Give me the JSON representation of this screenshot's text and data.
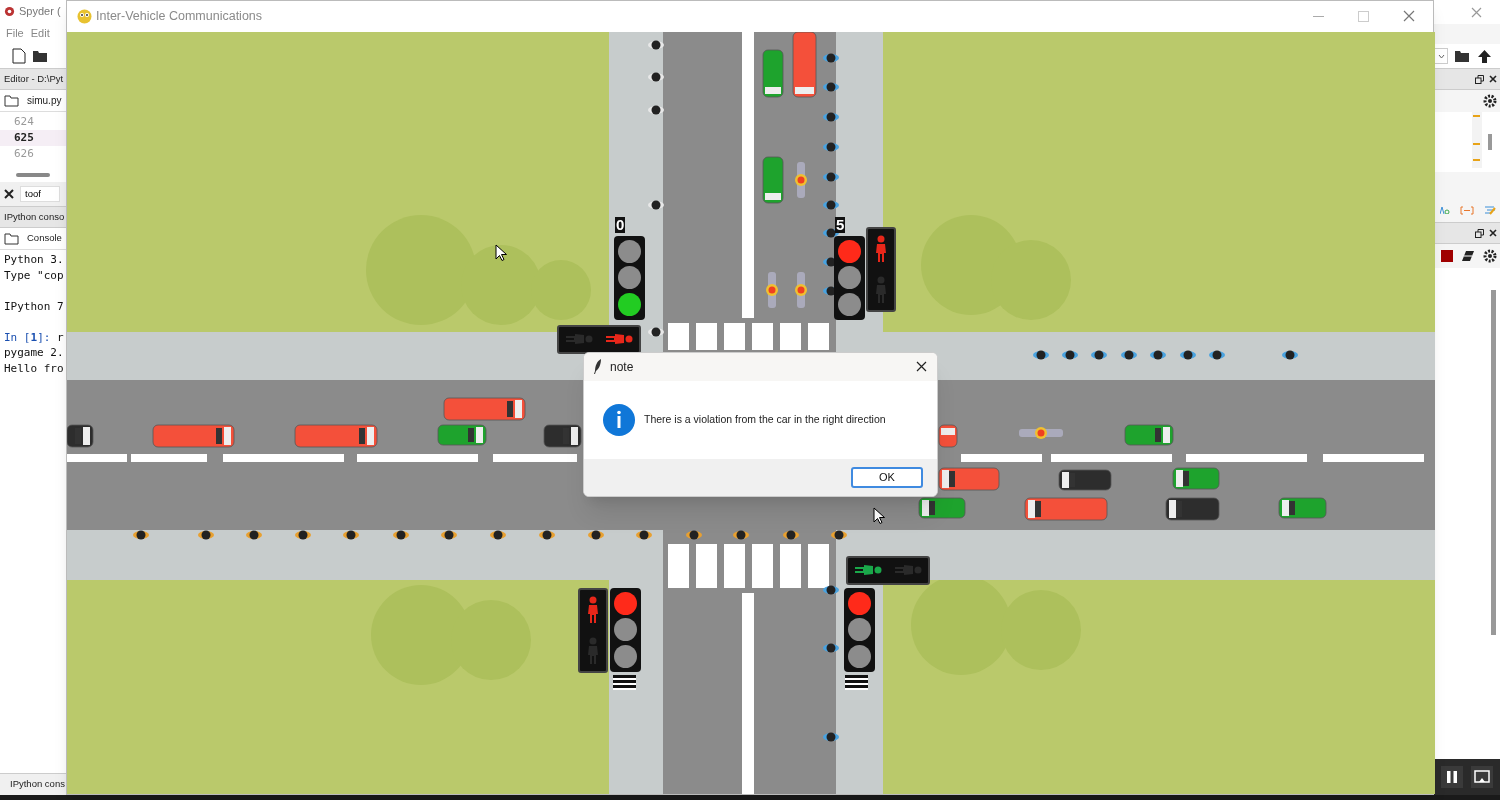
{
  "spyder": {
    "title": "Spyder (",
    "menu": [
      "File",
      "Edit"
    ],
    "editor_pane": "Editor - D:\\Pyt",
    "editor_tab": "simu.py",
    "line_numbers": [
      {
        "text": "624",
        "current": false
      },
      {
        "text": "625",
        "current": true
      },
      {
        "text": "626",
        "current": false
      }
    ],
    "find_field": "toof",
    "console_pane": "IPython conso",
    "console_tab": "Console",
    "console_blocks": [
      {
        "lines": [
          {
            "kind": "output",
            "text": "Python 3."
          },
          {
            "kind": "output",
            "text": "Type \"cop"
          }
        ]
      },
      {
        "lines": [
          {
            "kind": "output",
            "text": "IPython 7"
          }
        ]
      },
      {
        "lines": [
          {
            "kind": "prompt",
            "prompt": "In [**1**]:",
            "text": "r"
          },
          {
            "kind": "output",
            "text": "pygame 2."
          },
          {
            "kind": "output",
            "text": "Hello fro"
          }
        ]
      }
    ],
    "bottom_tab": "IPython cons"
  },
  "sim_window": {
    "title": "Inter-Vehicle Communications",
    "traffic_lights": [
      {
        "counter": "0",
        "lamps": [
          {
            "on": false
          },
          {
            "on": false
          },
          {
            "on": true
          }
        ]
      },
      {
        "counter": "5",
        "lamps": [
          {
            "on": true
          },
          {
            "on": false
          },
          {
            "on": false
          }
        ]
      },
      {
        "lamps": [
          {
            "on": true
          },
          {
            "on": false
          },
          {
            "on": false
          }
        ]
      },
      {
        "lamps": [
          {
            "on": true
          },
          {
            "on": false
          },
          {
            "on": false
          }
        ]
      }
    ],
    "pedestrian_signals": [
      {
        "lamps": [
          {
            "on": true
          },
          {
            "on": false
          }
        ]
      },
      {
        "lamps": [
          {
            "on": true
          },
          {
            "on": false
          }
        ]
      },
      {
        "lamps": [
          {
            "on": true
          },
          {
            "on": false
          }
        ]
      },
      {
        "lamps": [
          {
            "on": false
          },
          {
            "on": true
          }
        ]
      }
    ]
  },
  "dialog": {
    "title": "note",
    "message": "There is a violation from the car in the right direction",
    "button": "OK"
  }
}
